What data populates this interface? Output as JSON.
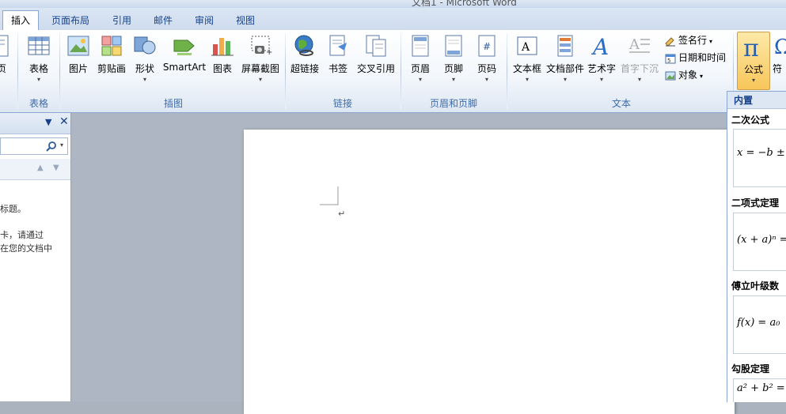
{
  "window": {
    "title": "文档1 - Microsoft Word"
  },
  "tabs": [
    {
      "label": "插入",
      "active": true
    },
    {
      "label": "页面布局",
      "active": false
    },
    {
      "label": "引用",
      "active": false
    },
    {
      "label": "邮件",
      "active": false
    },
    {
      "label": "审阅",
      "active": false
    },
    {
      "label": "视图",
      "active": false
    }
  ],
  "ribbon": {
    "pages_partial_label": "页",
    "groups": {
      "table": {
        "label": "表格",
        "buttons": [
          {
            "label": "表格"
          }
        ]
      },
      "illustrations": {
        "label": "插图",
        "buttons": [
          {
            "label": "图片"
          },
          {
            "label": "剪贴画"
          },
          {
            "label": "形状"
          },
          {
            "label": "SmartArt"
          },
          {
            "label": "图表"
          },
          {
            "label": "屏幕截图"
          }
        ]
      },
      "links": {
        "label": "链接",
        "buttons": [
          {
            "label": "超链接"
          },
          {
            "label": "书签"
          },
          {
            "label": "交叉引用"
          }
        ]
      },
      "header_footer": {
        "label": "页眉和页脚",
        "buttons": [
          {
            "label": "页眉"
          },
          {
            "label": "页脚"
          },
          {
            "label": "页码"
          }
        ]
      },
      "text": {
        "label": "文本",
        "buttons": [
          {
            "label": "文本框"
          },
          {
            "label": "文档部件"
          },
          {
            "label": "艺术字"
          },
          {
            "label": "首字下沉"
          }
        ],
        "small_buttons": [
          {
            "label": "签名行"
          },
          {
            "label": "日期和时间"
          },
          {
            "label": "对象"
          }
        ]
      },
      "symbols": {
        "buttons": [
          {
            "label": "公式"
          },
          {
            "label": "符"
          }
        ]
      }
    }
  },
  "nav_pane": {
    "text_line1": "标题。",
    "text_line2": "卡，请通过",
    "text_line3": "在您的文档中"
  },
  "document": {
    "paragraph_mark": "↵"
  },
  "equation_gallery": {
    "header": "内置",
    "items": [
      {
        "category": "二次公式",
        "preview": "x = −b ±"
      },
      {
        "category": "二项式定理",
        "preview": "(x + a)ⁿ ="
      },
      {
        "category": "傅立叶级数",
        "preview": "f(x) = a₀"
      },
      {
        "category": "勾股定理",
        "preview": "a² + b² ="
      }
    ]
  }
}
